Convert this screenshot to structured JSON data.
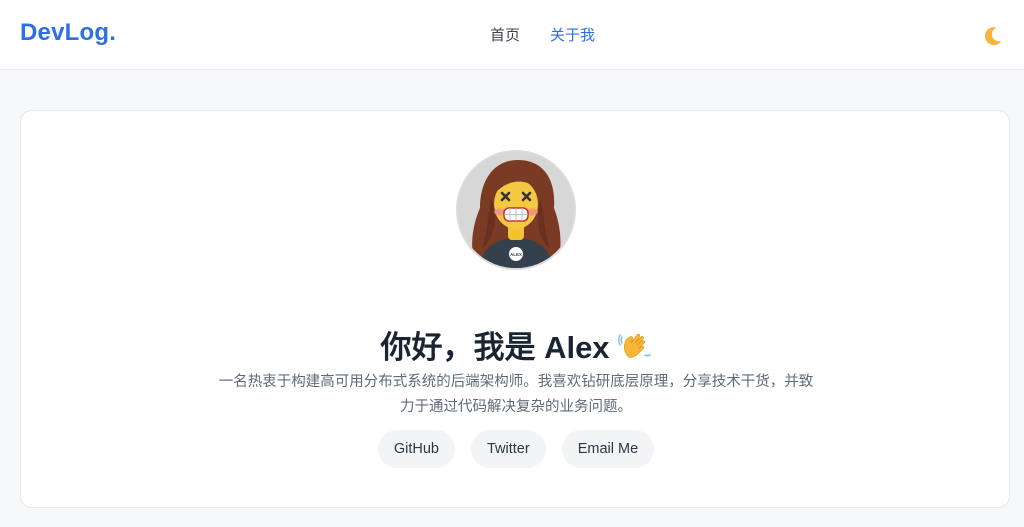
{
  "header": {
    "brand": "DevLog.",
    "nav": [
      {
        "label": "首页",
        "active": false
      },
      {
        "label": "关于我",
        "active": true
      }
    ],
    "theme_toggle_icon": "moon-icon"
  },
  "profile": {
    "avatar_badge_text": "ALEX",
    "headline": "你好，我是 Alex",
    "headline_icon": "waving-hand-icon",
    "bio": "一名热衷于构建高可用分布式系统的后端架构师。我喜欢钻研底层原理，分享技术干货，并致力于通过代码解决复杂的业务问题。",
    "links": [
      {
        "label": "GitHub"
      },
      {
        "label": "Twitter"
      },
      {
        "label": "Email Me"
      }
    ]
  },
  "colors": {
    "accent": "#2f6fe4",
    "page_bg": "#f7f8fa",
    "card_bg": "#ffffff",
    "button_bg": "#f3f4f6"
  }
}
